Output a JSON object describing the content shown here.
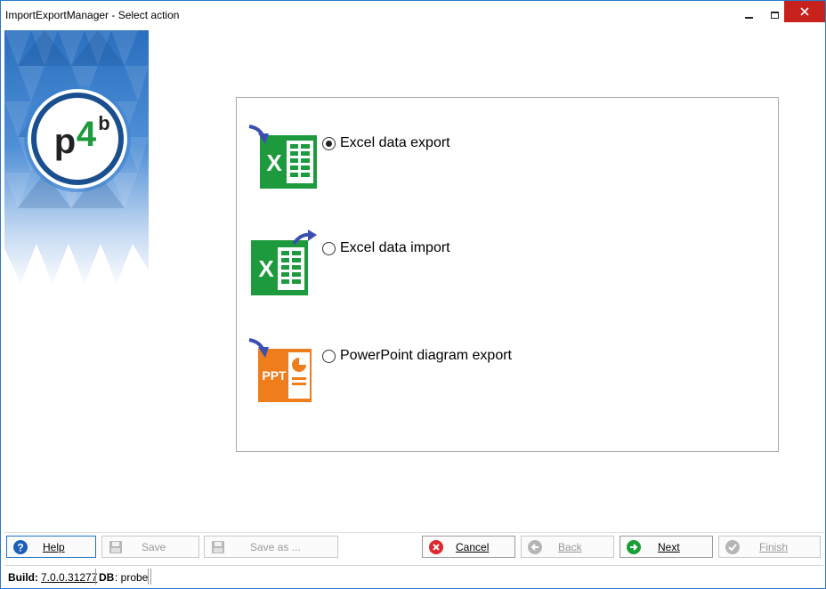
{
  "window": {
    "title": "ImportExportManager - Select action",
    "controls": {
      "minimize": "minimize",
      "maximize": "maximize",
      "close": "close"
    }
  },
  "banner": {
    "logo_text": "p4b",
    "logo_sup": "b"
  },
  "options": [
    {
      "label": "Excel data export",
      "icon": "excel-export-icon",
      "selected": true
    },
    {
      "label": "Excel data import",
      "icon": "excel-import-icon",
      "selected": false
    },
    {
      "label": "PowerPoint diagram export",
      "icon": "powerpoint-export-icon",
      "selected": false,
      "icon_text": "PPT"
    }
  ],
  "toolbar": {
    "help": "Help",
    "save": "Save",
    "save_as": "Save as ...",
    "cancel": "Cancel",
    "back": "Back",
    "next": "Next",
    "finish": "Finish"
  },
  "status": {
    "build_label": "Build:",
    "build_value": "7.0.0.31277",
    "db_label": "DB",
    "db_value": ": probe"
  },
  "colors": {
    "excel_green": "#1e9a3e",
    "ppt_orange": "#f07d1c",
    "arrow_blue": "#3b4fb0",
    "cancel_red": "#e0262e",
    "next_green": "#1a9e36",
    "help_blue": "#1c5fb8",
    "banner_blue": "#2a6fbf"
  }
}
